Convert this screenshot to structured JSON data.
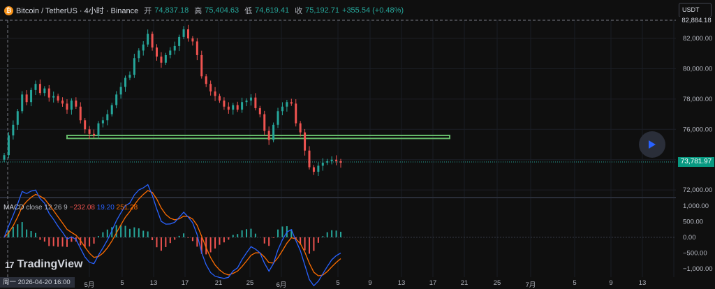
{
  "legend": {
    "title": "Bitcoin / TetherUS · 4小时 · Binance",
    "open_label": "开",
    "open": "74,837.18",
    "high_label": "高",
    "high": "75,404.63",
    "low_label": "低",
    "low": "74,619.41",
    "close_label": "收",
    "close": "75,192.71",
    "change": "+355.54 (+0.48%)"
  },
  "currency": "USDT",
  "crosshair_price": "82,884.18",
  "last_price": "73,781.97",
  "price_axis": [
    "82,000.00",
    "80,000.00",
    "78,000.00",
    "76,000.00",
    "74,000.00",
    "72,000.00"
  ],
  "macd": {
    "name": "MACD",
    "params": "close 12 26 9",
    "hist": "−232.08",
    "macd": "19.20",
    "signal": "251.28",
    "axis": [
      "1,000.00",
      "500.00",
      "0.00",
      "−500.00",
      "−1,000.00"
    ]
  },
  "time_axis": [
    "5月",
    "5",
    "13",
    "17",
    "21",
    "25",
    "6月",
    "5",
    "9",
    "13",
    "17",
    "21",
    "25",
    "7月",
    "5",
    "9",
    "13"
  ],
  "crosshair_time": "周一 2026-04-20   16:00",
  "logo": "TradingView",
  "colors": {
    "up": "#26a69a",
    "down": "#ef5350",
    "macd": "#2962ff",
    "signal": "#ff6d00",
    "zone": "#66bb6a"
  },
  "chart_data": {
    "type": "candlestick",
    "ylim": [
      71500,
      83200
    ],
    "zone": [
      75400,
      75600
    ],
    "closes": [
      74300,
      75600,
      76300,
      77200,
      78300,
      77800,
      78600,
      79000,
      78400,
      78700,
      78100,
      78200,
      77900,
      77700,
      77300,
      77900,
      77500,
      76600,
      76000,
      75700,
      75600,
      76400,
      76600,
      77000,
      77600,
      78300,
      78800,
      79400,
      79600,
      80700,
      81200,
      81600,
      82300,
      81400,
      80800,
      80400,
      80900,
      81200,
      81500,
      82100,
      82600,
      82000,
      81800,
      80900,
      79500,
      79000,
      78500,
      78200,
      77900,
      77500,
      77300,
      77600,
      77300,
      77800,
      77900,
      78100,
      77400,
      77000,
      75900,
      75300,
      76300,
      77200,
      77500,
      77800,
      77700,
      76400,
      75800,
      74600,
      73500,
      73200,
      73600,
      73800,
      73900,
      74000,
      73900,
      73800
    ]
  }
}
